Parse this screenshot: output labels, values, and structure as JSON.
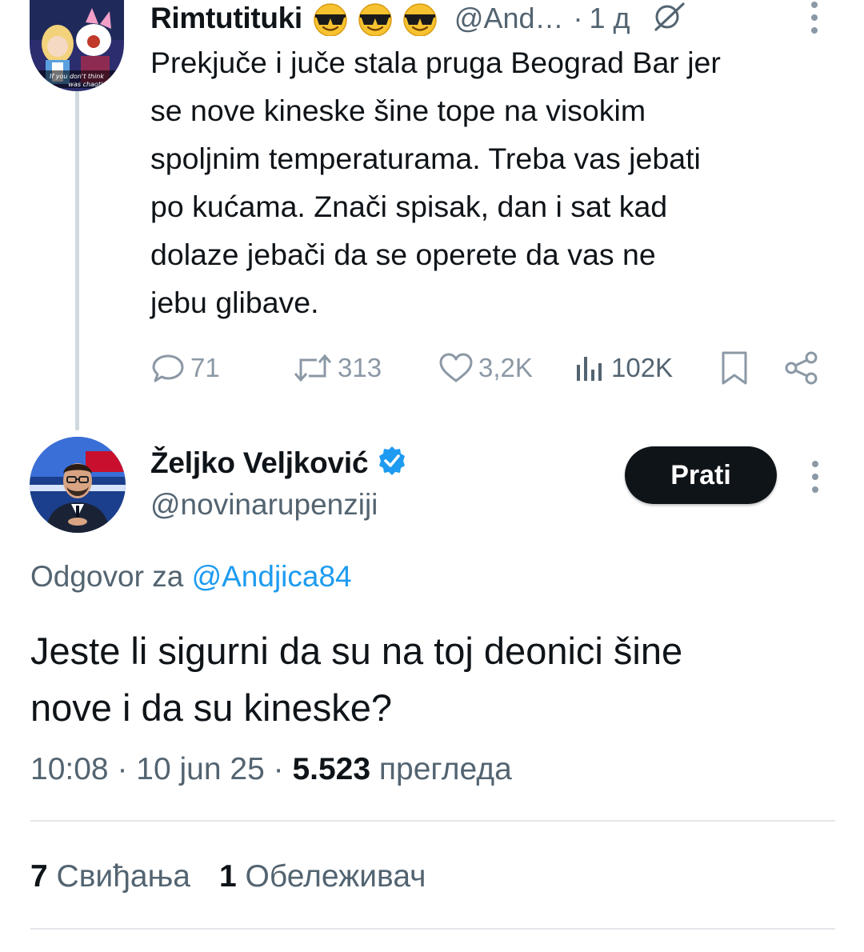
{
  "tweet1": {
    "display_name": "Rimtutituki",
    "handle": "@And…",
    "separator": "·",
    "time": "1 д",
    "text": "Prekjuče i juče stala pruga Beograd Bar jer\nse nove kineske šine tope na visokim\nspoljnim temperaturama. Treba vas jebati\npo kućama. Znači spisak, dan i sat kad\ndolaze jebači da se operete da vas ne\njebu glibave.",
    "avatar_caption": "If you don't think ... was chaotic",
    "replies": "71",
    "reposts": "313",
    "likes": "3,2K",
    "views": "102K"
  },
  "tweet2": {
    "display_name": "Željko Veljković",
    "handle": "@novinarupenziji",
    "follow_label": "Prati",
    "reply_prefix": "Odgovor za ",
    "reply_mention": "@Andjica84",
    "text": "Jeste li sigurni da su na toj deonici šine\nnove i da su kineske?",
    "time": "10:08",
    "date": "10 jun 25",
    "views_count": "5.523",
    "views_label": "прегледа",
    "likes_count": "7",
    "likes_label": "Свиђања",
    "bookmarks_count": "1",
    "bookmarks_label": "Обележивач"
  },
  "colors": {
    "text": "#0f1419",
    "secondary": "#536471",
    "icon_gray": "#8b98a5",
    "accent_blue": "#1d9bf0",
    "divider": "#e3e7ea",
    "thread_line": "#cfd9de"
  },
  "icons": [
    "sunglasses-emoji",
    "grok-icon",
    "more-vertical-icon",
    "reply-icon",
    "repost-icon",
    "like-icon",
    "views-icon",
    "bookmark-icon",
    "share-icon",
    "verified-badge-icon"
  ]
}
